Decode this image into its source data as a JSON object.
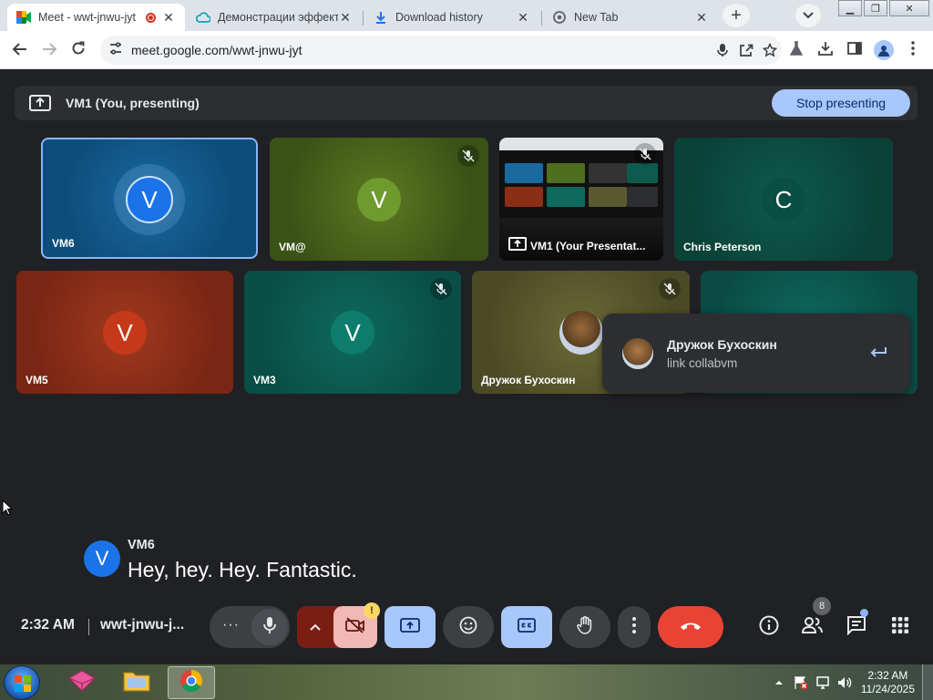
{
  "browser": {
    "tabs": [
      {
        "title": "Meet - wwt-jnwu-jyt",
        "active": true,
        "recording": true
      },
      {
        "title": "Демонстрации эффект",
        "active": false
      },
      {
        "title": "Download history",
        "active": false
      },
      {
        "title": "New Tab",
        "active": false
      }
    ],
    "tab_close_glyph": "✕",
    "new_tab_glyph": "+",
    "url": "meet.google.com/wwt-jnwu-jyt",
    "window_buttons": {
      "minimize": "▁",
      "maximize": "❐",
      "close": "✕"
    }
  },
  "meet": {
    "presenting_bar": {
      "label": "VM1 (You, presenting)",
      "stop_button": "Stop presenting"
    },
    "tiles": [
      {
        "name": "VM6",
        "initial": "V",
        "avatar_color": "#1a73e8",
        "muted": false,
        "speaking": true
      },
      {
        "name": "VM@",
        "initial": "V",
        "avatar_color": "#6f9a2e",
        "muted": true
      },
      {
        "name": "VM1 (Your Presentat...",
        "presentation": true,
        "muted": true
      },
      {
        "name": "Chris Peterson",
        "initial": "C",
        "avatar_color": "#0b5a4c",
        "muted": false
      },
      {
        "name": "VM5",
        "initial": "V",
        "avatar_color": "#c5391a",
        "muted": false
      },
      {
        "name": "VM3",
        "initial": "V",
        "avatar_color": "#0e7c6c",
        "muted": true
      },
      {
        "name": "Дружок Бухоскин",
        "muted": true,
        "photo_avatar": true
      },
      {
        "name": "",
        "muted": false
      }
    ],
    "chat_popup": {
      "sender": "Дружок Бухоскин",
      "message": "link collabvm"
    },
    "caption": {
      "speaker": "VM6",
      "initial": "V",
      "text": "Hey, hey. Hey. Fantastic."
    },
    "controls": {
      "time": "2:32 AM",
      "meeting_code": "wwt-jnwu-j...",
      "more_glyph": "···",
      "people_count": "8",
      "camera_warning": "!"
    },
    "colors": {
      "accent_blue": "#a8c7fa",
      "end_call_red": "#ea4335",
      "camera_off_red": "#f9b9b4"
    }
  },
  "taskbar": {
    "time": "2:32 AM",
    "date": "11/24/2025",
    "apps": [
      "windows-start",
      "app-pink-icon",
      "file-explorer",
      "chrome"
    ]
  }
}
